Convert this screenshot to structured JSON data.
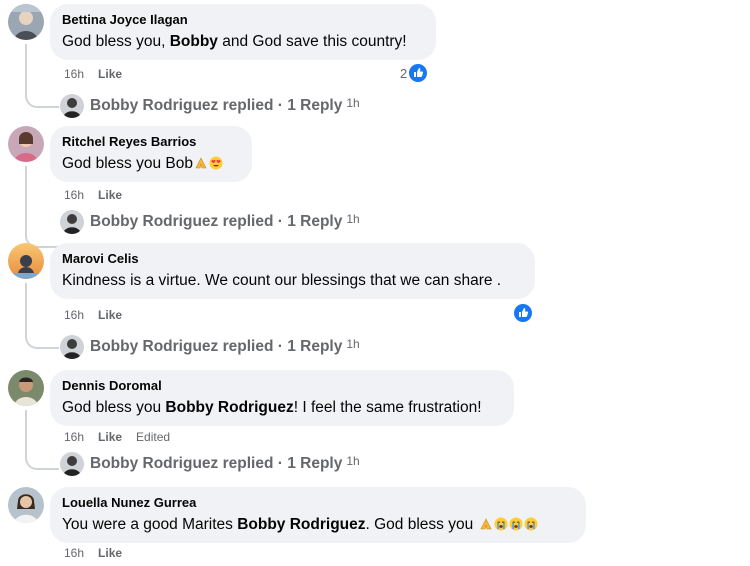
{
  "comments": [
    {
      "author": "Bettina Joyce Ilagan",
      "text": {
        "t1": "God bless you, ",
        "b1": "Bobby",
        "t2": " and God save this country!"
      },
      "time": "16h",
      "like": "Like",
      "reaction_count": "2",
      "reply": {
        "label": "Bobby Rodriguez replied · 1 Reply",
        "time": "1h"
      }
    },
    {
      "author": "Ritchel Reyes Barrios",
      "text": {
        "t1": "God bless you Bob"
      },
      "emojis": [
        "folded-hands-emoji",
        "heart-eyes-emoji"
      ],
      "time": "16h",
      "like": "Like",
      "reply": {
        "label": "Bobby Rodriguez replied · 1 Reply",
        "time": "1h"
      }
    },
    {
      "author": "Marovi Celis",
      "text": {
        "t1": "Kindness is a virtue. We count our blessings that we can share ."
      },
      "time": "16h",
      "like": "Like",
      "reply": {
        "label": "Bobby Rodriguez replied · 1 Reply",
        "time": "1h"
      }
    },
    {
      "author": "Dennis Doromal",
      "text": {
        "t1": "God bless you ",
        "b1": "Bobby Rodriguez",
        "t2": "! I feel the same frustration!"
      },
      "time": "16h",
      "like": "Like",
      "edited": "Edited",
      "reply": {
        "label": "Bobby Rodriguez replied · 1 Reply",
        "time": "1h"
      }
    },
    {
      "author": "Louella Nunez Gurrea",
      "text": {
        "t1": "You were a good Marites ",
        "b1": "Bobby Rodriguez",
        "t2": ". God bless you "
      },
      "emojis": [
        "folded-hands-emoji",
        "crying-face-emoji",
        "crying-face-emoji",
        "crying-face-emoji"
      ],
      "time": "16h",
      "like": "Like"
    }
  ],
  "colors": {
    "bubble": "#f0f2f5",
    "meta_text": "#65676b",
    "like_blue": "#1877f2"
  }
}
